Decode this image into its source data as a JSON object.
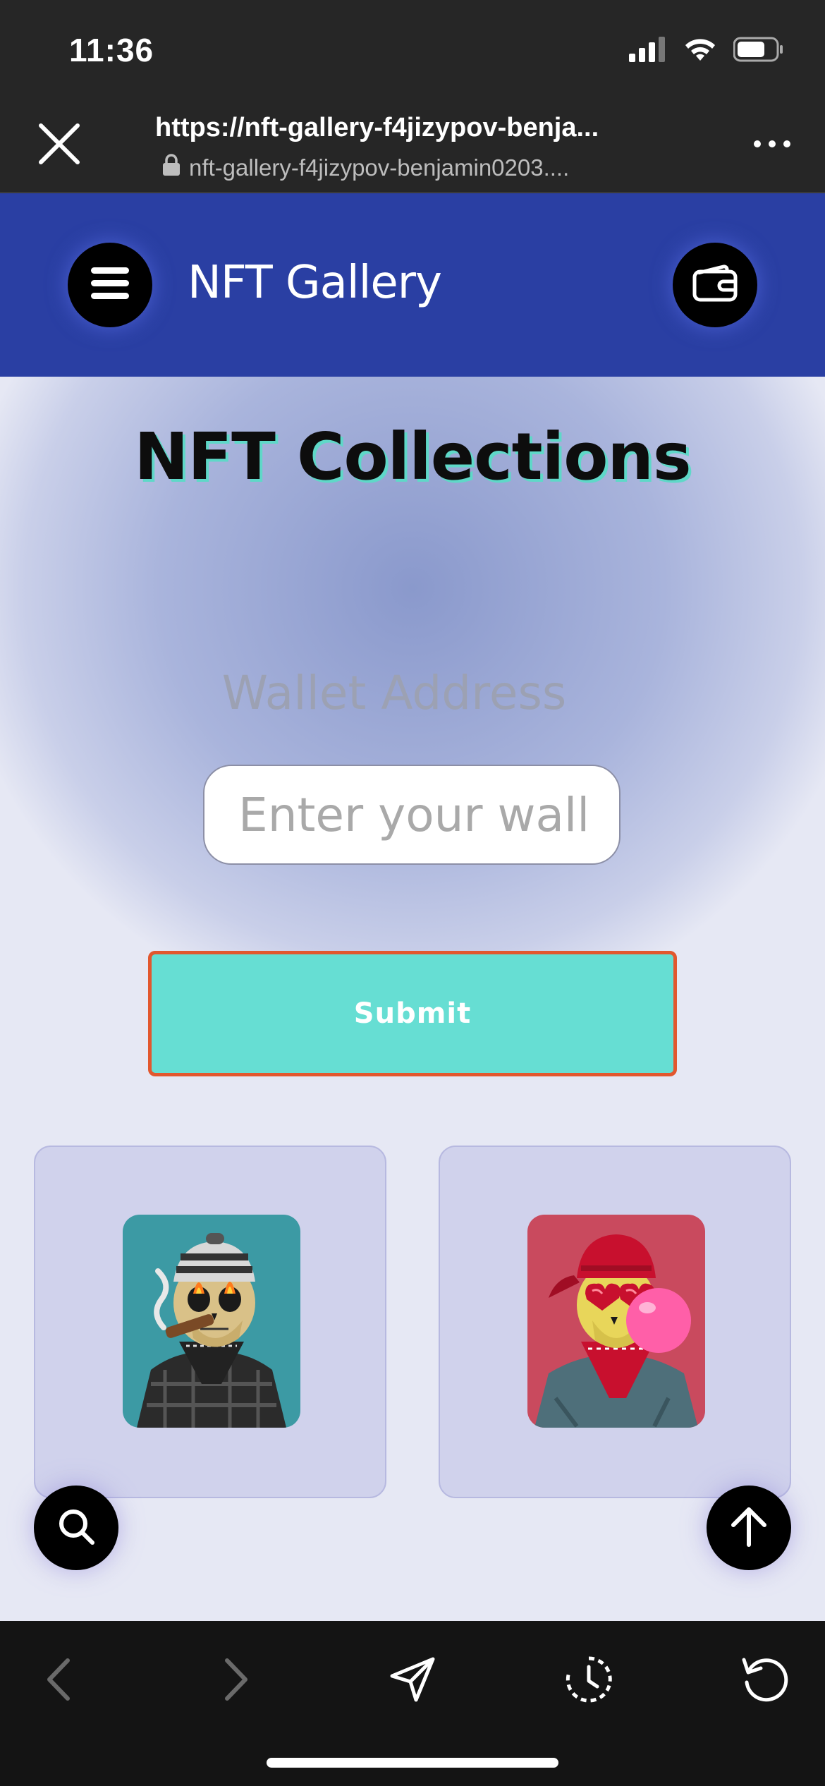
{
  "status_bar": {
    "time": "11:36",
    "icons": [
      "cellular-signal-icon",
      "wifi-icon",
      "battery-icon"
    ]
  },
  "browser": {
    "url_title": "https://nft-gallery-f4jizypov-benja...",
    "url_domain": "nft-gallery-f4jizypov-benjamin0203....",
    "close_icon": "close-icon",
    "more_icon": "more-icon"
  },
  "header": {
    "title": "NFT Gallery",
    "menu_icon": "menu-icon",
    "wallet_icon": "wallet-icon",
    "background_color": "#2a3fa3"
  },
  "main": {
    "title": "NFT Collections",
    "wallet_label": "Wallet Address",
    "wallet_input": {
      "placeholder": "Enter your wallet address",
      "value": ""
    },
    "submit_label": "Submit",
    "submit_color": "#66ded3",
    "submit_border_color": "#e2572e",
    "cards": [
      {
        "image": "skull-with-beanie-and-cigar-nft",
        "background": "#3c9aa4"
      },
      {
        "image": "skull-with-red-cap-and-bubblegum-nft",
        "background": "#c94a5e"
      }
    ]
  },
  "fabs": {
    "search_icon": "search-icon",
    "scroll_top_icon": "arrow-up-icon"
  },
  "toolbar": {
    "items": [
      "back-icon",
      "forward-icon",
      "share-icon",
      "history-icon",
      "reload-icon"
    ]
  }
}
